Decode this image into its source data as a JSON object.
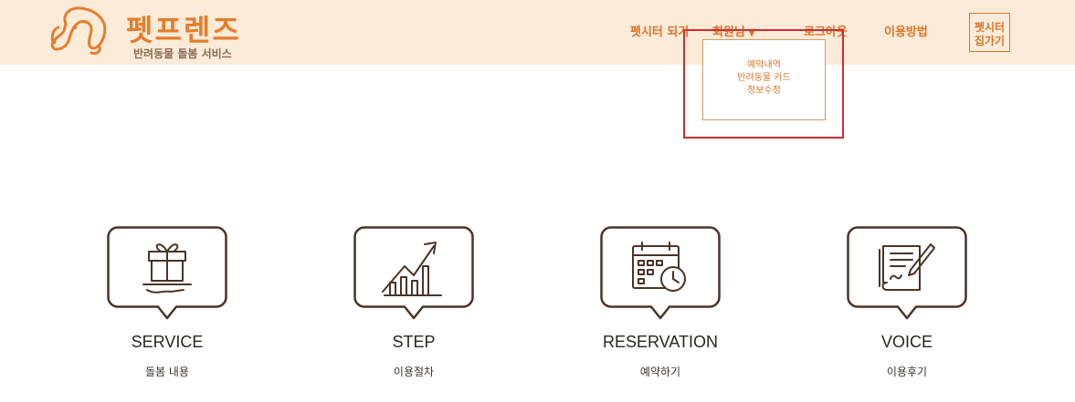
{
  "brand": {
    "name": "펫프렌즈",
    "subtitle": "반려동물 돌봄 서비스",
    "color": "#e57d2b"
  },
  "nav": {
    "items": [
      {
        "label": "펫시터 되기"
      },
      {
        "label": "회원님"
      },
      {
        "label": "로그아웃"
      },
      {
        "label": "이용방법"
      }
    ],
    "caret": "▼",
    "sitter_button": {
      "line1": "펫시터",
      "line2": "집가기"
    }
  },
  "dropdown": {
    "items": [
      {
        "label": "예약내역"
      },
      {
        "label": "반려동물 카드"
      },
      {
        "label": "정보수정"
      }
    ]
  },
  "features": [
    {
      "title": "SERVICE",
      "subtitle": "돌봄 내용",
      "icon": "gift-icon"
    },
    {
      "title": "STEP",
      "subtitle": "이용절차",
      "icon": "growth-chart-icon"
    },
    {
      "title": "RESERVATION",
      "subtitle": "예약하기",
      "icon": "calendar-clock-icon"
    },
    {
      "title": "VOICE",
      "subtitle": "이용후기",
      "icon": "document-pen-icon"
    }
  ],
  "colors": {
    "header_bg": "#fcebd9",
    "accent": "#d9742a",
    "highlight": "#d9282f",
    "icon_stroke": "#4a3426"
  }
}
